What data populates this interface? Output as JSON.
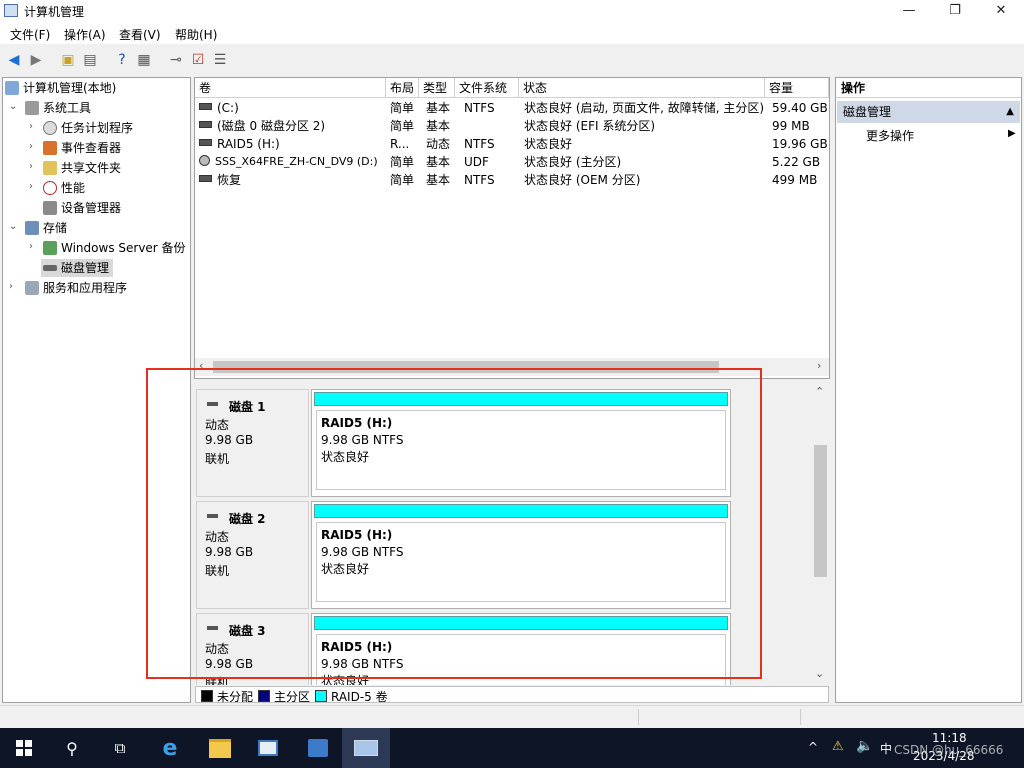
{
  "window": {
    "title": "计算机管理"
  },
  "menu": [
    "文件(F)",
    "操作(A)",
    "查看(V)",
    "帮助(H)"
  ],
  "tree": {
    "root": "计算机管理(本地)",
    "system_tools": "系统工具",
    "task_scheduler": "任务计划程序",
    "event_viewer": "事件查看器",
    "shared_folders": "共享文件夹",
    "performance": "性能",
    "device_manager": "设备管理器",
    "storage": "存储",
    "wsb": "Windows Server 备份",
    "disk_mgmt": "磁盘管理",
    "services": "服务和应用程序"
  },
  "volumes": {
    "headers": [
      "卷",
      "布局",
      "类型",
      "文件系统",
      "状态",
      "容量"
    ],
    "rows": [
      [
        "(C:)",
        "简单",
        "基本",
        "NTFS",
        "状态良好 (启动, 页面文件, 故障转储, 主分区)",
        "59.40 GB"
      ],
      [
        "(磁盘 0 磁盘分区 2)",
        "简单",
        "基本",
        "",
        "状态良好 (EFI 系统分区)",
        "99 MB"
      ],
      [
        "RAID5 (H:)",
        "R...",
        "动态",
        "NTFS",
        "状态良好",
        "19.96 GB"
      ],
      [
        "SSS_X64FRE_ZH-CN_DV9 (D:)",
        "简单",
        "基本",
        "UDF",
        "状态良好 (主分区)",
        "5.22 GB"
      ],
      [
        "恢复",
        "简单",
        "基本",
        "NTFS",
        "状态良好 (OEM 分区)",
        "499 MB"
      ]
    ]
  },
  "disks": [
    {
      "name": "磁盘 1",
      "type": "动态",
      "size": "9.98 GB",
      "status": "联机",
      "vol": "RAID5  (H:)",
      "vol_size": "9.98 GB NTFS",
      "vol_status": "状态良好"
    },
    {
      "name": "磁盘 2",
      "type": "动态",
      "size": "9.98 GB",
      "status": "联机",
      "vol": "RAID5  (H:)",
      "vol_size": "9.98 GB NTFS",
      "vol_status": "状态良好"
    },
    {
      "name": "磁盘 3",
      "type": "动态",
      "size": "9.98 GB",
      "status": "联机",
      "vol": "RAID5  (H:)",
      "vol_size": "9.98 GB NTFS",
      "vol_status": "状态良好"
    }
  ],
  "legend": [
    {
      "label": "未分配",
      "color": "#000000"
    },
    {
      "label": "主分区",
      "color": "#000080"
    },
    {
      "label": "RAID-5 卷",
      "color": "#00ffff"
    }
  ],
  "actions": {
    "title": "操作",
    "section": "磁盘管理",
    "more": "更多操作"
  },
  "taskbar": {
    "time": "11:18",
    "date": "2023/4/28",
    "ime": "中",
    "watermark": "CSDN @hu_66666"
  },
  "colors": {
    "accent": "#e5301f",
    "raid5": "#00ffff",
    "taskbar": "#0d1526"
  }
}
